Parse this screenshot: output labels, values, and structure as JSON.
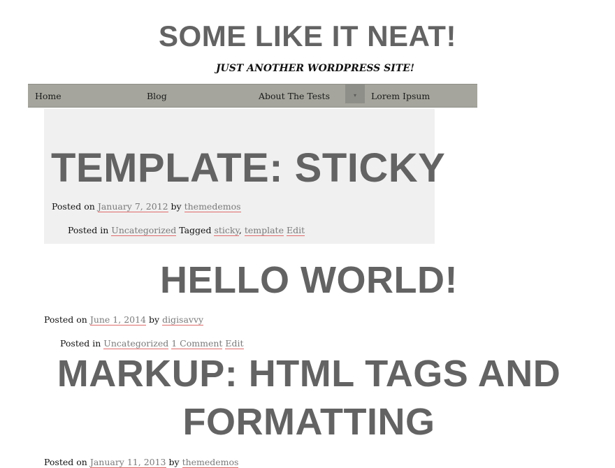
{
  "site": {
    "title": "SOME LIKE IT NEAT!",
    "description": "JUST ANOTHER WORDPRESS SITE!"
  },
  "nav": {
    "items": [
      "Home",
      "Blog",
      "About The Tests",
      "Lorem Ipsum"
    ],
    "toggle_icon": "▾"
  },
  "posts": [
    {
      "title": "TEMPLATE: STICKY",
      "posted_on_label": "Posted on",
      "date": "January 7, 2012",
      "by_label": "by",
      "author": "themedemos",
      "posted_in_label": "Posted in",
      "category": "Uncategorized",
      "tagged_label": "Tagged",
      "tags": [
        "sticky",
        "template"
      ],
      "tag_sep": ",",
      "edit_label": "Edit"
    },
    {
      "title": "HELLO WORLD!",
      "posted_on_label": "Posted on",
      "date": "June 1, 2014",
      "by_label": "by",
      "author": "digisavvy",
      "posted_in_label": "Posted in",
      "category": "Uncategorized",
      "comments": "1 Comment",
      "edit_label": "Edit"
    },
    {
      "title_line1": "MARKUP: HTML TAGS AND",
      "title_line2": "FORMATTING",
      "posted_on_label": "Posted on",
      "date": "January 11, 2013",
      "by_label": "by",
      "author": "themedemos"
    }
  ]
}
